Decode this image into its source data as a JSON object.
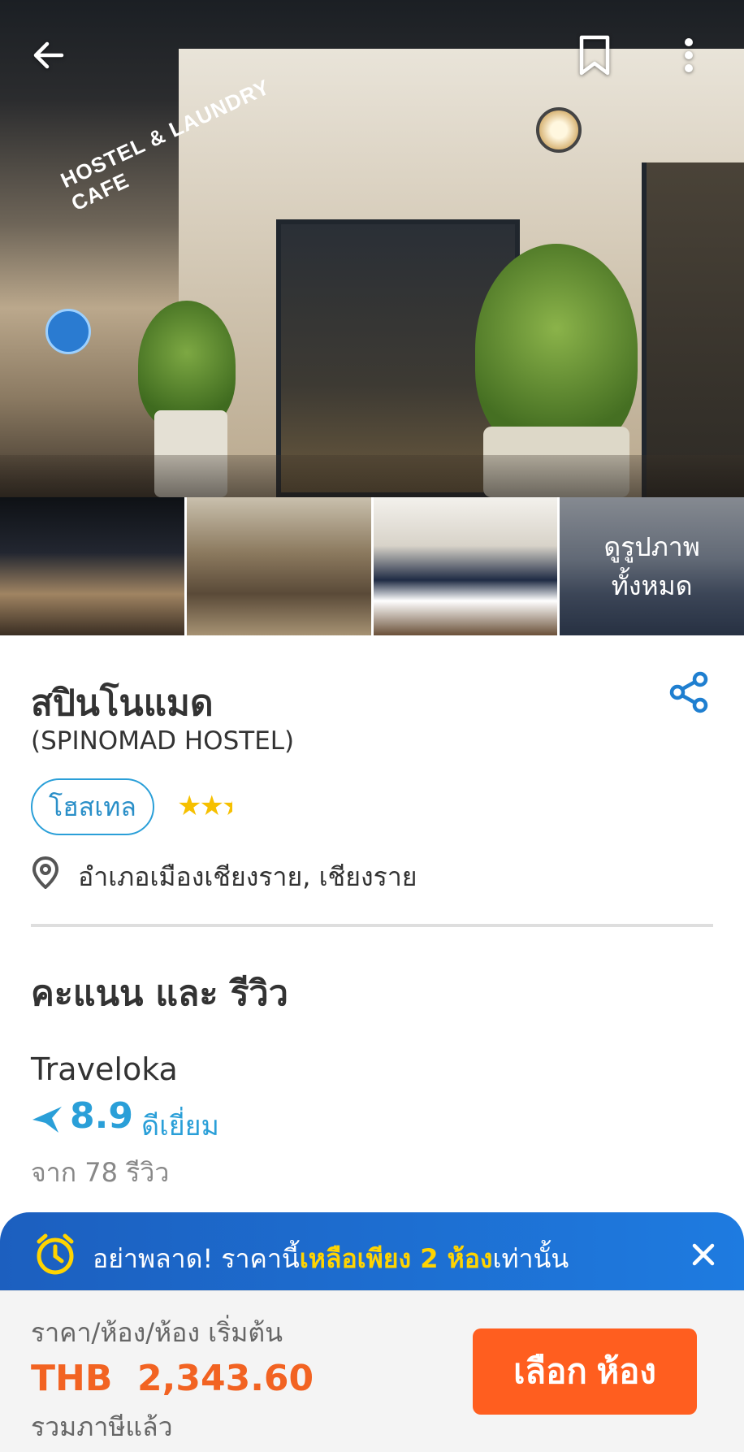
{
  "header": {
    "back_icon": "arrow-left-icon",
    "bookmark_icon": "bookmark-icon",
    "more_icon": "more-vertical-icon"
  },
  "hero": {
    "sign_text": "HOSTEL & LAUNDRY CAFE"
  },
  "gallery": {
    "more_photos_label": "ดูรูปภาพ ทั้งหมด"
  },
  "hotel": {
    "name": "สปินโนแมด",
    "subtitle": "(SPINOMAD HOSTEL)",
    "type": "โฮสเทล",
    "stars": "★★★",
    "location": "อำเภอเมืองเชียงราย, เชียงราย"
  },
  "reviews": {
    "section_title": "คะแนน และ รีวิว",
    "provider": "Traveloka",
    "score": "8.9",
    "score_label": "ดีเยี่ยม",
    "count_text": "จาก 78 รีวิว"
  },
  "banner": {
    "prefix": "อย่าพลาด! ราคานี้",
    "highlight": "เหลือเพียง 2 ห้อง",
    "suffix": "เท่านั้น"
  },
  "pricebar": {
    "label": "ราคา/ห้อง/ห้อง เริ่มต้น",
    "price": "THB  2,343.60",
    "tax_note": "รวมภาษีแล้ว",
    "button_label": "เลือก ห้อง"
  },
  "colors": {
    "accent_blue": "#2a9fd8",
    "price_orange": "#f26322",
    "button_orange": "#ff5e1f",
    "banner_blue": "#1e6fd6",
    "highlight_yellow": "#ffd400",
    "star_yellow": "#f6c000"
  }
}
